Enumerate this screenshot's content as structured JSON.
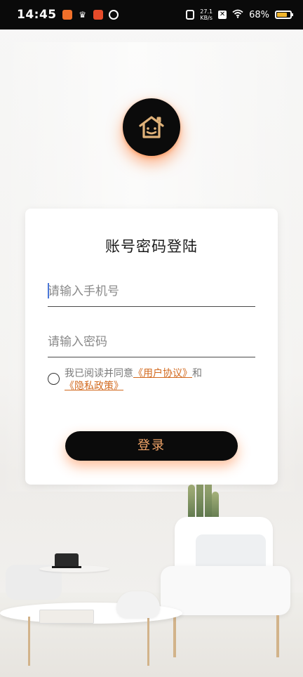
{
  "status_bar": {
    "time": "14:45",
    "net_speed_value": "27.1",
    "net_speed_unit": "KB/s",
    "battery_text": "68%",
    "battery_level": 0.68,
    "icons": [
      "app-orange-icon",
      "crown-icon",
      "app-red-icon",
      "swirl-icon",
      "vibrate-icon",
      "x-icon",
      "wifi-icon",
      "battery-icon"
    ]
  },
  "logo": {
    "icon": "house-smile-icon"
  },
  "login": {
    "title": "账号密码登陆",
    "phone_placeholder": "请输入手机号",
    "password_placeholder": "请输入密码",
    "agree_prefix": "我已阅读并同意",
    "user_agreement": "《用户协议》",
    "and": "和",
    "privacy_policy": "《隐私政策》",
    "login_button": "登录"
  },
  "colors": {
    "accent": "#d2691e",
    "button_text": "#f0a468",
    "glow": "#ff6e1e"
  }
}
